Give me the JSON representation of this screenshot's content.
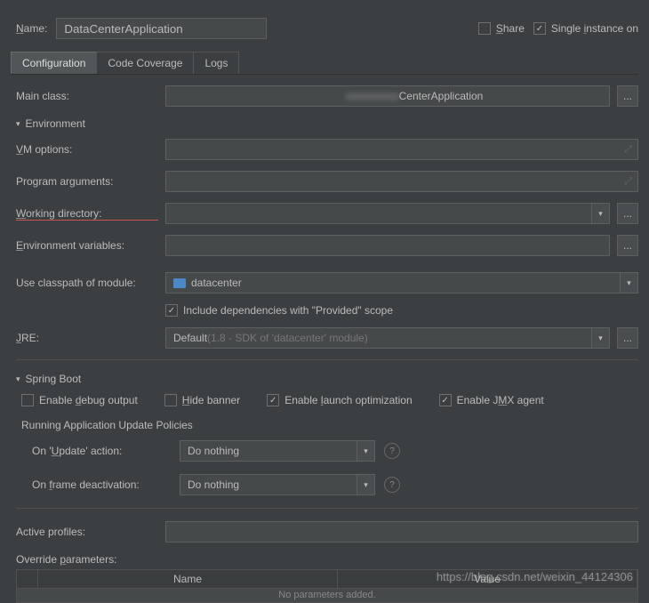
{
  "header": {
    "name_label": "Name:",
    "name_value": "DataCenterApplication",
    "share_label": "Share",
    "single_instance_label": "Single instance on"
  },
  "tabs": {
    "config": "Configuration",
    "coverage": "Code Coverage",
    "logs": "Logs"
  },
  "config": {
    "main_class_label": "Main class:",
    "main_class_value": "CenterApplication",
    "environment_section": "Environment",
    "vm_options_label": "VM options:",
    "program_args_label": "Program arguments:",
    "working_dir_label": "Working directory:",
    "env_vars_label": "Environment variables:",
    "classpath_label": "Use classpath of module:",
    "classpath_value": "datacenter",
    "include_deps_label": "Include dependencies with \"Provided\" scope",
    "jre_label": "JRE:",
    "jre_value_prefix": "Default",
    "jre_value_detail": " (1.8 - SDK of 'datacenter' module)",
    "spring_boot_section": "Spring Boot",
    "enable_debug_label": "Enable debug output",
    "hide_banner_label": "Hide banner",
    "enable_launch_label": "Enable launch optimization",
    "enable_jmx_label": "Enable JMX agent",
    "update_policies_label": "Running Application Update Policies",
    "on_update_label": "On 'Update' action:",
    "on_frame_label": "On frame deactivation:",
    "do_nothing": "Do nothing",
    "active_profiles_label": "Active profiles:",
    "override_params_label": "Override parameters:",
    "col_name": "Name",
    "col_value": "Value",
    "no_params": "No parameters added."
  },
  "watermark": "https://blog.csdn.net/weixin_44124306"
}
